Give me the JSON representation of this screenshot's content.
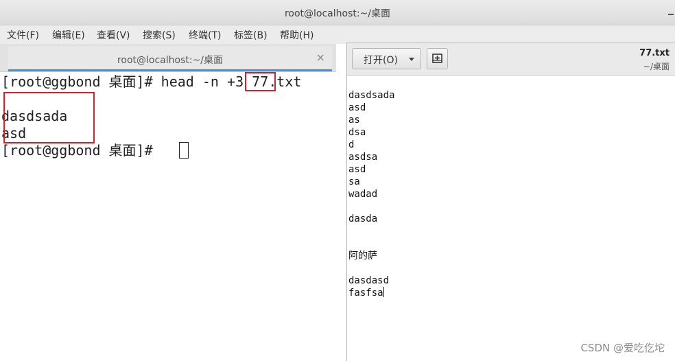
{
  "terminal": {
    "window_title": "root@localhost:~/桌面",
    "menu": [
      "文件(F)",
      "编辑(E)",
      "查看(V)",
      "搜索(S)",
      "终端(T)",
      "标签(B)",
      "帮助(H)"
    ],
    "tab_title": "root@localhost:~/桌面",
    "tab_close": "×",
    "lines": {
      "prompt_open": "[",
      "prompt_body": "root@ggbond 桌面",
      "prompt_close": "]# ",
      "cmd_head": "head",
      "cmd_flag": "-n",
      "cmd_arg": "+3",
      "cmd_file": "77.txt",
      "out1": "dasdsada",
      "out2": "asd",
      "prompt2": "[root@ggbond 桌面]# "
    },
    "highlight_color": "#d0242c"
  },
  "gedit": {
    "open_label": "打开(O)",
    "file_name": "77.txt",
    "file_path": "~/桌面",
    "content_lines": [
      "dasdsada",
      "asd",
      "as",
      "dsa",
      "d",
      "asdsa",
      "asd",
      "sa",
      "wadad",
      "",
      "dasda",
      "",
      "",
      "阿的萨",
      "",
      "dasdasd",
      "fasfsa"
    ]
  },
  "watermark": "CSDN @爱吃仡坨"
}
